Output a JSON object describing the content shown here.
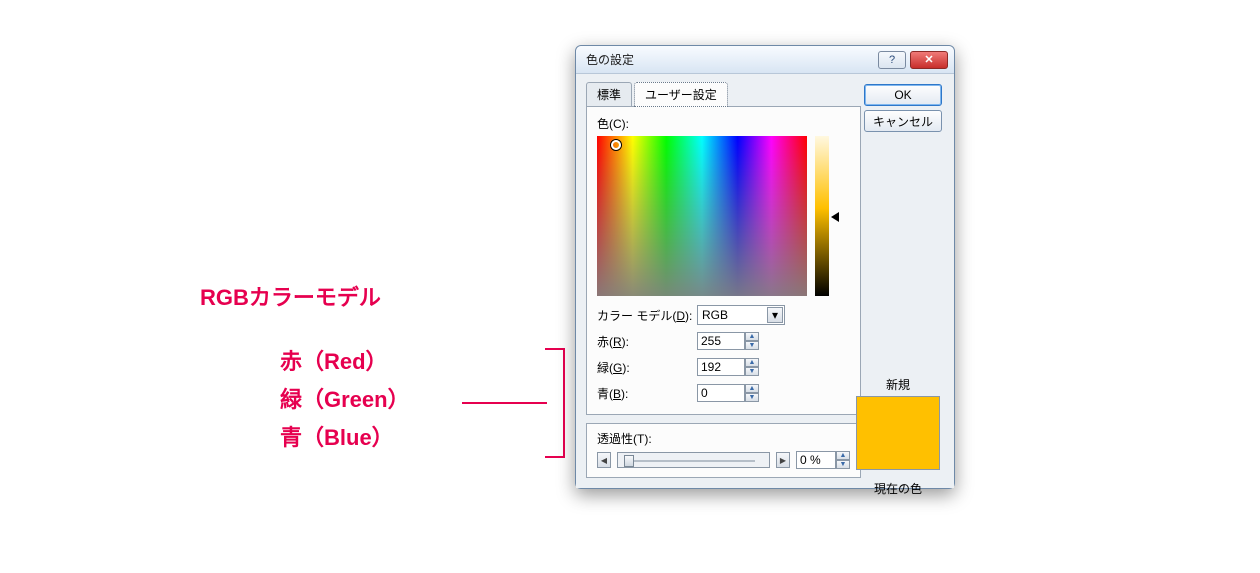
{
  "annotation": {
    "title": "RGBカラーモデル",
    "red": "赤（Red）",
    "green": "緑（Green）",
    "blue": "青（Blue）"
  },
  "dialog": {
    "title": "色の設定",
    "help_symbol": "?",
    "close_symbol": "✕",
    "tabs": {
      "standard": "標準",
      "custom": "ユーザー設定"
    },
    "ok": "OK",
    "cancel": "キャンセル",
    "color_label_prefix": "色(",
    "color_label_u": "C",
    "color_label_suffix": "):",
    "model_label_prefix": "カラー モデル(",
    "model_label_u": "D",
    "model_label_suffix": "):",
    "model_value": "RGB",
    "red_label_prefix": "赤(",
    "red_label_u": "R",
    "red_label_suffix": "):",
    "red_value": "255",
    "green_label_prefix": "緑(",
    "green_label_u": "G",
    "green_label_suffix": "):",
    "green_value": "192",
    "blue_label_prefix": "青(",
    "blue_label_u": "B",
    "blue_label_suffix": "):",
    "blue_value": "0",
    "trans_label_prefix": "透過性(",
    "trans_label_u": "T",
    "trans_label_suffix": "):",
    "trans_value": "0 %",
    "new_label": "新規",
    "current_label": "現在の色",
    "selected_color": "#ffc000"
  }
}
